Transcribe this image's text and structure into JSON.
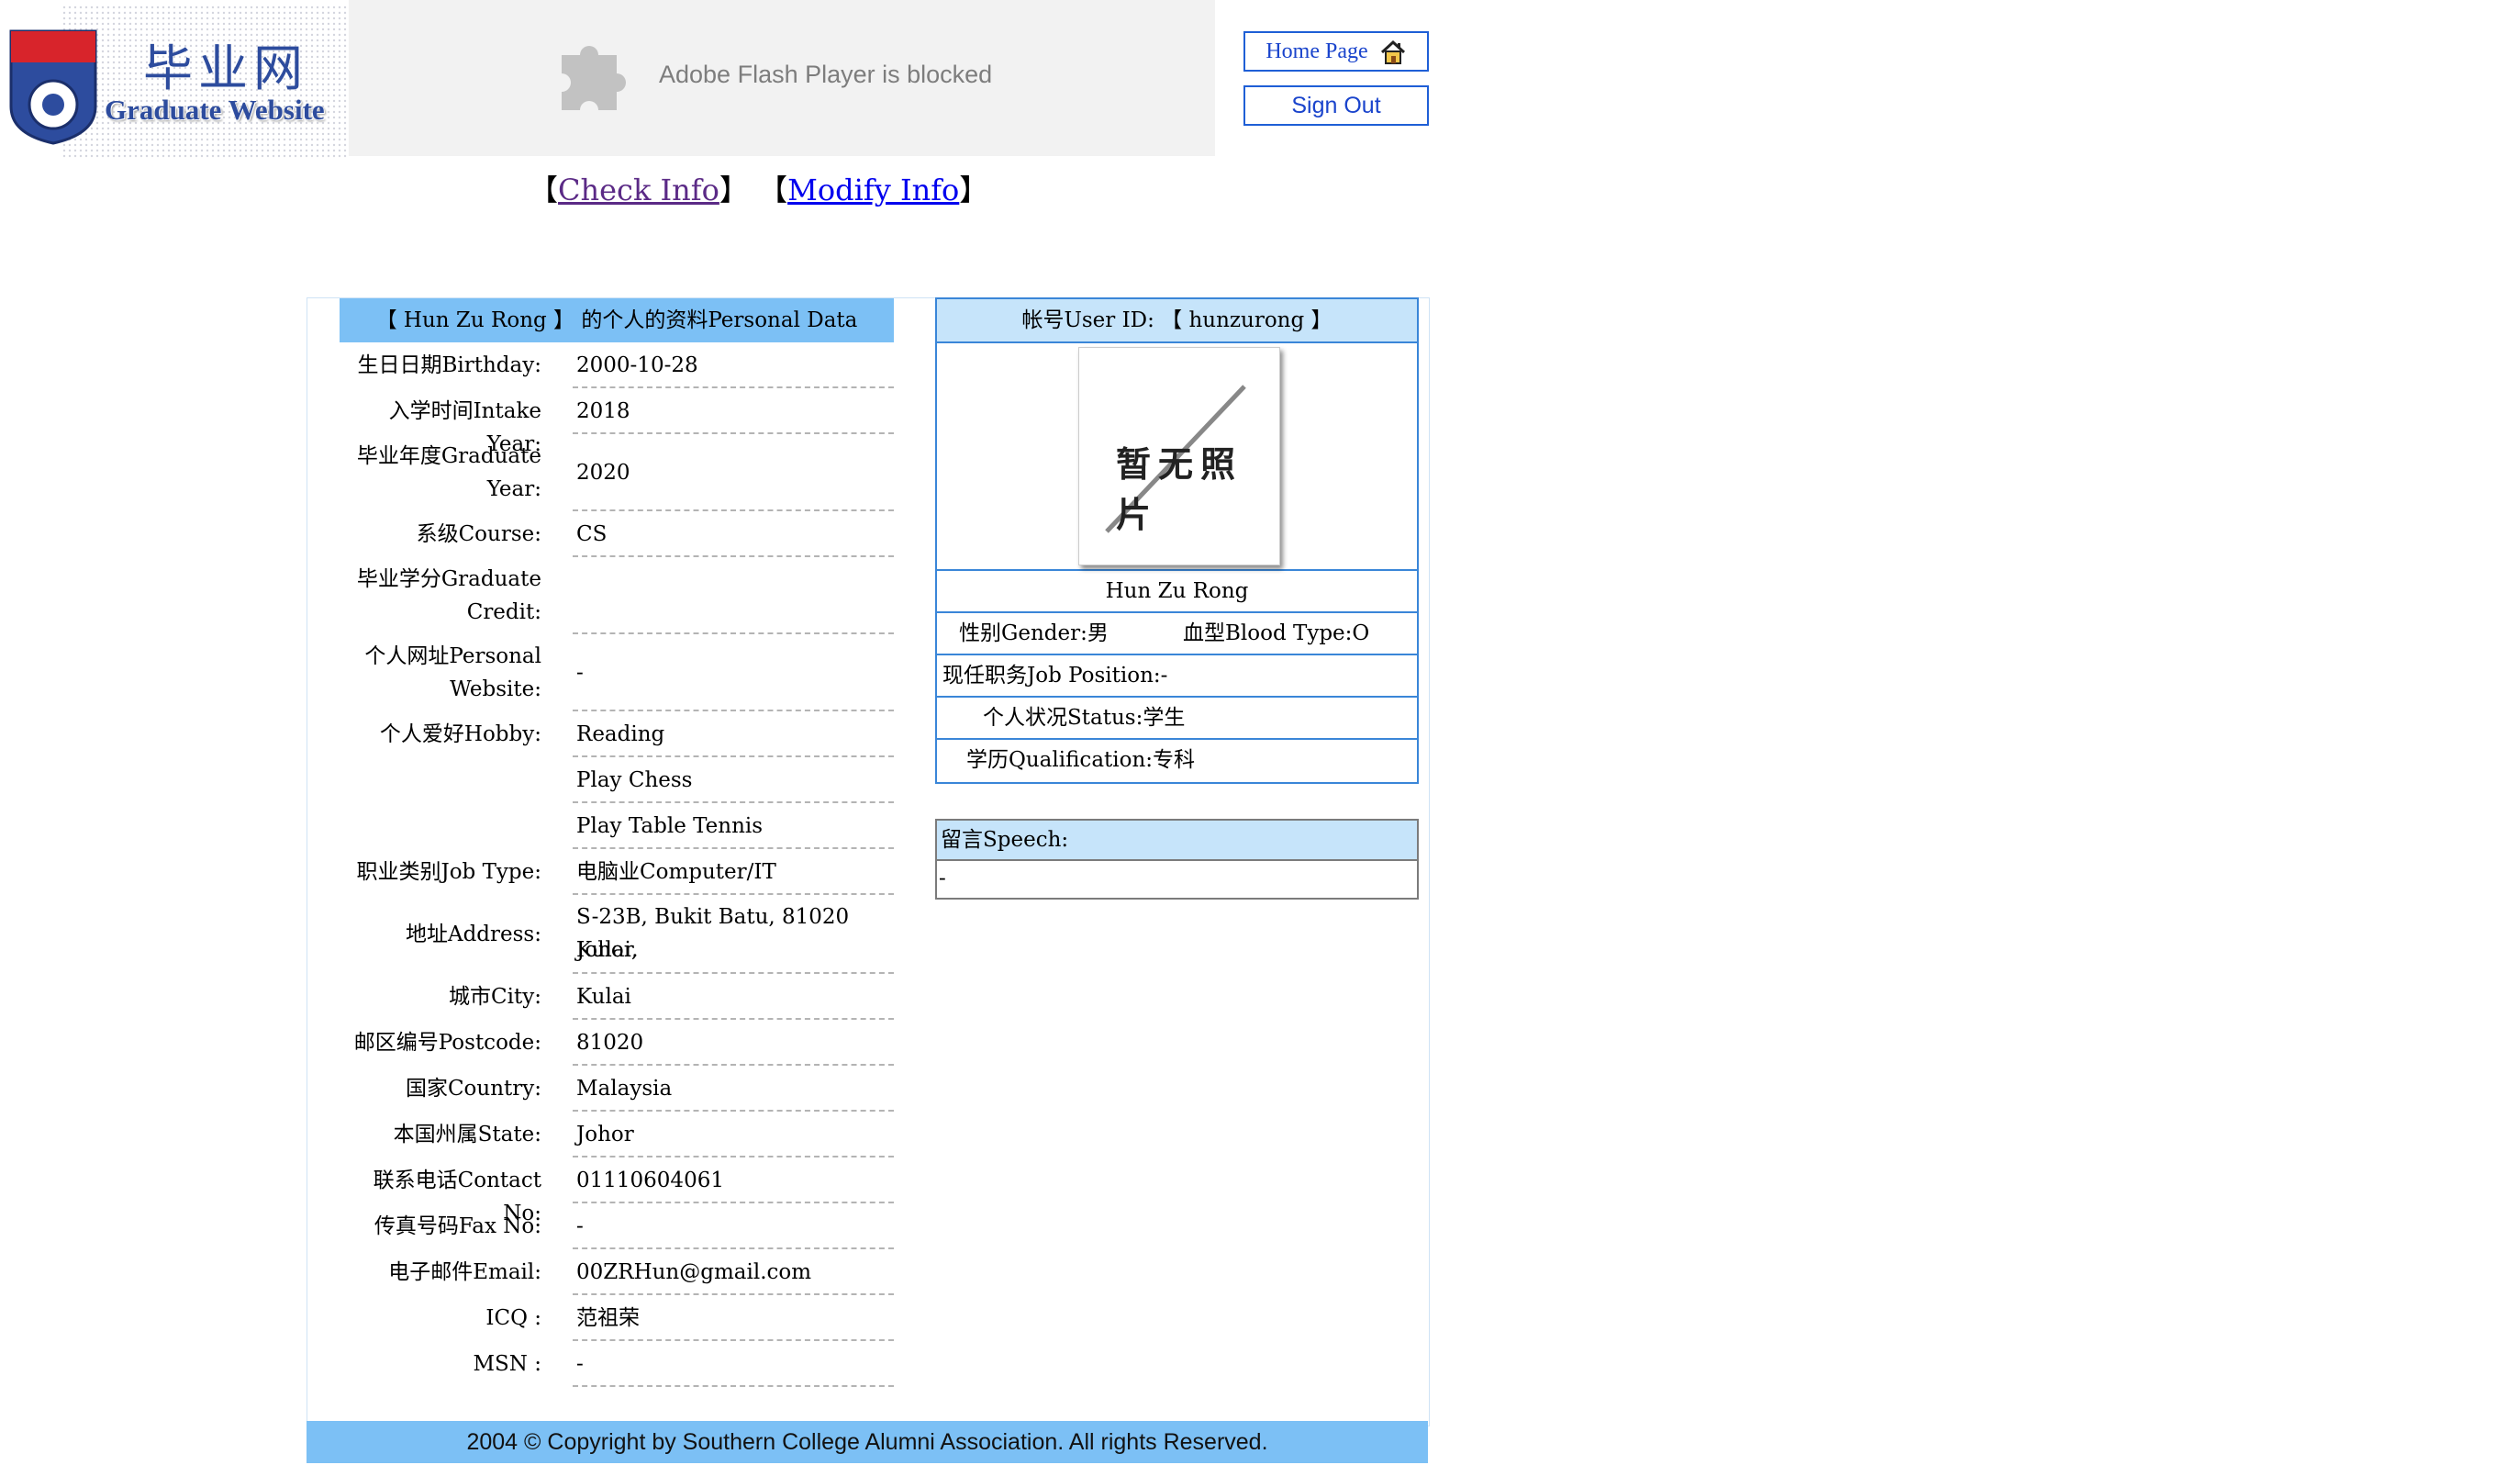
{
  "header": {
    "logo_chinese": "毕业网",
    "logo_english": "Graduate Website",
    "flash_message": "Adobe Flash Player is blocked",
    "home_label": "Home Page",
    "signout_label": "Sign Out"
  },
  "nav": {
    "check_info": "Check Info",
    "modify_info": "Modify Info",
    "open_bracket": "【",
    "close_bracket": "】"
  },
  "personal": {
    "header": "【 Hun Zu Rong 】 的个人的资料Personal Data",
    "rows": [
      {
        "label": "生日日期Birthday:",
        "value": "2000-10-28"
      },
      {
        "label": "入学时间Intake Year:",
        "value": "2018"
      },
      {
        "label": "毕业年度Graduate",
        "label2": "Year:",
        "value": "2020"
      },
      {
        "label": "系级Course:",
        "value": "CS"
      },
      {
        "label": "毕业学分Graduate",
        "label2": "Credit:",
        "value": ""
      },
      {
        "label": "个人网址Personal",
        "label2": "Website:",
        "value": "-"
      },
      {
        "label": "个人爱好Hobby:",
        "value": "Reading"
      },
      {
        "label": "",
        "value": "Play Chess"
      },
      {
        "label": "",
        "value": "Play Table Tennis"
      },
      {
        "label": "职业类别Job Type:",
        "value": "电脑业Computer/IT"
      },
      {
        "label": "地址Address:",
        "value": "S-23B, Bukit Batu, 81020 Kulai,",
        "value2": "Johor."
      },
      {
        "label": "城市City:",
        "value": "Kulai"
      },
      {
        "label": "邮区编号Postcode:",
        "value": "81020"
      },
      {
        "label": "国家Country:",
        "value": "Malaysia"
      },
      {
        "label": "本国州属State:",
        "value": "Johor"
      },
      {
        "label": "联系电话Contact No:",
        "value": "01110604061"
      },
      {
        "label": "传真号码Fax No:",
        "value": "-"
      },
      {
        "label": "电子邮件Email:",
        "value": "00ZRHun@gmail.com"
      },
      {
        "label": "ICQ :",
        "value": "范祖荣"
      },
      {
        "label": "MSN :",
        "value": "-"
      }
    ]
  },
  "profile": {
    "user_id": "帐号User ID: 【 hunzurong 】",
    "photo_placeholder": "暂无照片",
    "name": "Hun Zu Rong",
    "gender": "性别Gender:男",
    "blood_type": "血型Blood Type:O",
    "job_position": "现任职务Job Position:-",
    "status": "个人状况Status:学生",
    "qualification": "学历Qualification:专科",
    "speech_title": "留言Speech:",
    "speech_body": "-"
  },
  "footer": {
    "copyright": "2004 © Copyright by Southern College Alumni Association. All rights Reserved."
  },
  "colors": {
    "header_blue": "#7cc0f5",
    "light_blue": "#c6e4fa",
    "border_blue": "#3a86d8",
    "link_visited": "#5b2a86",
    "link": "#0000ee"
  }
}
